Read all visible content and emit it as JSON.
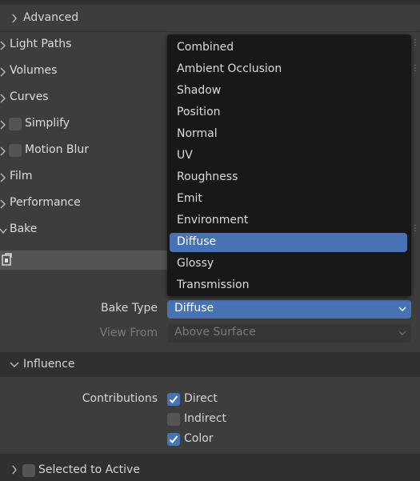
{
  "panels": {
    "advanced": "Advanced",
    "light_paths": "Light Paths",
    "volumes": "Volumes",
    "curves": "Curves",
    "simplify": "Simplify",
    "motion_blur": "Motion Blur",
    "film": "Film",
    "performance": "Performance",
    "bake": "Bake"
  },
  "bake_menu": {
    "items": [
      "Combined",
      "Ambient Occlusion",
      "Shadow",
      "Position",
      "Normal",
      "UV",
      "Roughness",
      "Emit",
      "Environment",
      "Diffuse",
      "Glossy",
      "Transmission"
    ],
    "selected": "Diffuse"
  },
  "bake_settings": {
    "bake_type_label": "Bake Type",
    "bake_type_value": "Diffuse",
    "view_from_label": "View From",
    "view_from_value": "Above Surface"
  },
  "influence": {
    "title": "Influence",
    "contributions_label": "Contributions",
    "direct": {
      "label": "Direct",
      "checked": true
    },
    "indirect": {
      "label": "Indirect",
      "checked": false
    },
    "color": {
      "label": "Color",
      "checked": true
    }
  },
  "selected_to_active": {
    "label": "Selected to Active",
    "checked": false
  },
  "colors": {
    "accent": "#4772b3",
    "menu_bg": "#181818",
    "panel_bg": "#3d3d3d",
    "background": "#303030"
  }
}
